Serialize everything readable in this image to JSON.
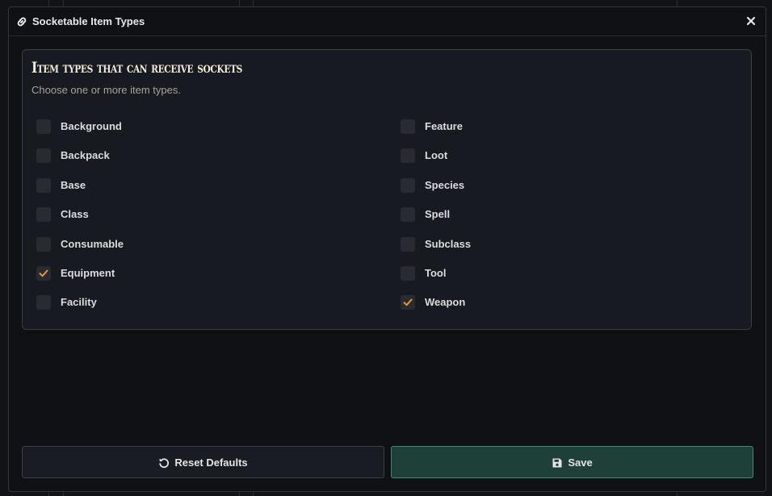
{
  "dialog": {
    "title": "Socketable Item Types",
    "title_icon": "link-icon",
    "close_icon": "close-icon"
  },
  "panel": {
    "heading": "Item types that can receive sockets",
    "subtitle": "Choose one or more item types."
  },
  "options": {
    "left": [
      {
        "label": "Background",
        "checked": false
      },
      {
        "label": "Backpack",
        "checked": false
      },
      {
        "label": "Base",
        "checked": false
      },
      {
        "label": "Class",
        "checked": false
      },
      {
        "label": "Consumable",
        "checked": false
      },
      {
        "label": "Equipment",
        "checked": true
      },
      {
        "label": "Facility",
        "checked": false
      }
    ],
    "right": [
      {
        "label": "Feature",
        "checked": false
      },
      {
        "label": "Loot",
        "checked": false
      },
      {
        "label": "Species",
        "checked": false
      },
      {
        "label": "Spell",
        "checked": false
      },
      {
        "label": "Subclass",
        "checked": false
      },
      {
        "label": "Tool",
        "checked": false
      },
      {
        "label": "Weapon",
        "checked": true
      }
    ]
  },
  "buttons": {
    "reset_label": "Reset Defaults",
    "reset_icon": "undo-icon",
    "save_label": "Save",
    "save_icon": "floppy-disk-icon"
  },
  "colors": {
    "checkmark": "#e8963a",
    "save_bg": "#1f4038",
    "save_border": "#3d8a6c"
  }
}
